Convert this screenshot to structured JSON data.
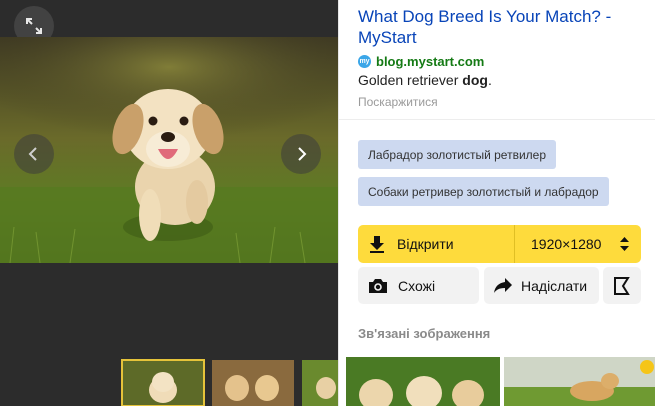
{
  "viewer": {
    "icons": [
      "expand-icon",
      "crop-icon",
      "chevron-left-icon",
      "chevron-right-icon"
    ]
  },
  "info": {
    "title": "What Dog Breed Is Your Match? - MyStart",
    "source_icon_text": "my",
    "source": "blog.mystart.com",
    "description_plain": "Golden retriever ",
    "description_bold": "dog",
    "description_end": ".",
    "complain": "Поскаржитися"
  },
  "tags": [
    "Лабрадор золотистый ретвилер",
    "Собаки ретривер золотистый и лабрадор"
  ],
  "actions": {
    "open_label": "Відкрити",
    "size_label": "1920×1280",
    "similar_label": "Схожі",
    "share_label": "Надіслати"
  },
  "related": {
    "title": "Зв'язані зображення"
  },
  "colors": {
    "link": "#0844b8",
    "source_green": "#147a14",
    "accent_yellow": "#fedb3c",
    "tag_bg": "#cdd9f0",
    "viewer_bg": "#2c2c2c"
  }
}
